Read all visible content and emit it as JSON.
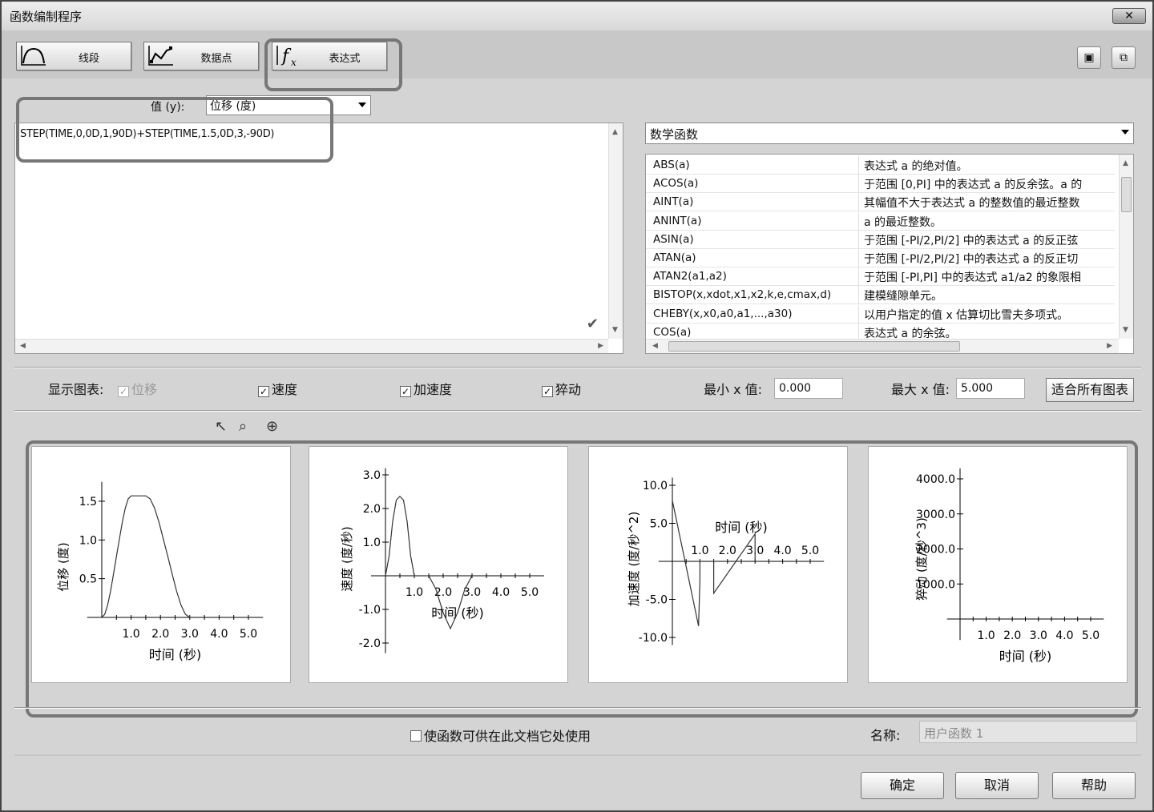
{
  "window": {
    "title": "函数编制程序",
    "close_label": "✕"
  },
  "toolbar": {
    "buttons": [
      {
        "label": "线段",
        "icon": "segment-curve-icon"
      },
      {
        "label": "数据点",
        "icon": "data-points-icon"
      },
      {
        "label": "表达式",
        "icon": "fx-icon"
      }
    ],
    "save_icon": "save-icon",
    "open_icon": "open-icon"
  },
  "value": {
    "label": "值 (y):",
    "selected": "位移 (度)"
  },
  "editor": {
    "expression": "STEP(TIME,0,0D,1,90D)+STEP(TIME,1.5,0D,3,-90D)"
  },
  "functions": {
    "category": "数学函数",
    "rows": [
      {
        "name": "ABS(a)",
        "desc": "表达式 a 的绝对值。"
      },
      {
        "name": "ACOS(a)",
        "desc": "于范围 [0,PI] 中的表达式 a 的反余弦。a 的"
      },
      {
        "name": "AINT(a)",
        "desc": "其幅值不大于表达式 a 的整数值的最近整数"
      },
      {
        "name": "ANINT(a)",
        "desc": "a 的最近整数。"
      },
      {
        "name": "ASIN(a)",
        "desc": "于范围 [-PI/2,PI/2] 中的表达式 a 的反正弦"
      },
      {
        "name": "ATAN(a)",
        "desc": "于范围 [-PI/2,PI/2] 中的表达式 a 的反正切"
      },
      {
        "name": "ATAN2(a1,a2)",
        "desc": "于范围 [-PI,PI] 中的表达式 a1/a2 的象限相"
      },
      {
        "name": "BISTOP(x,xdot,x1,x2,k,e,cmax,d)",
        "desc": "建模缝隙单元。"
      },
      {
        "name": "CHEBY(x,x0,a0,a1,...,a30)",
        "desc": "以用户指定的值 x 估算切比雪夫多项式。"
      },
      {
        "name": "COS(a)",
        "desc": "表达式 a 的余弦。"
      }
    ]
  },
  "display": {
    "label": "显示图表:",
    "displacement": "位移",
    "velocity": "速度",
    "acceleration": "加速度",
    "jerk": "猝动",
    "min_x_label": "最小 x 值:",
    "min_x": "0.000",
    "max_x_label": "最大 x 值:",
    "max_x": "5.000",
    "fit_label": "适合所有图表",
    "checked": {
      "displacement": true,
      "velocity": true,
      "acceleration": true,
      "jerk": true
    }
  },
  "footer": {
    "share_label": "使函数可供在此文档它处使用",
    "share_checked": false,
    "name_label": "名称:",
    "name_value": "用户函数 1",
    "ok": "确定",
    "cancel": "取消",
    "help": "帮助"
  },
  "chart_data": [
    {
      "type": "line",
      "xlabel": "时间 (秒)",
      "ylabel": "位移 (度)",
      "xticks": [
        "1.0",
        "2.0",
        "3.0",
        "4.0",
        "5.0"
      ],
      "yticks": [
        "0.5",
        "1.0",
        "1.5"
      ],
      "yvals": [
        0.5,
        1.0,
        1.5
      ],
      "xlim": [
        0,
        5.5
      ],
      "ylim": [
        0,
        1.75
      ],
      "x": [
        0,
        0.1,
        0.2,
        0.3,
        0.4,
        0.5,
        0.6,
        0.7,
        0.8,
        0.9,
        1,
        1.5,
        1.65,
        1.8,
        1.95,
        2.1,
        2.25,
        2.4,
        2.55,
        2.7,
        2.85,
        3
      ],
      "y": [
        0,
        0.04,
        0.16,
        0.34,
        0.56,
        0.79,
        1.01,
        1.23,
        1.41,
        1.53,
        1.57,
        1.57,
        1.53,
        1.41,
        1.23,
        1.01,
        0.79,
        0.56,
        0.34,
        0.16,
        0.04,
        0
      ]
    },
    {
      "type": "line",
      "xlabel": "时间 (秒)",
      "ylabel": "速度 (度/秒)",
      "xticks": [
        "1.0",
        "2.0",
        "3.0",
        "4.0",
        "5.0"
      ],
      "yticks": [
        "3.0",
        "2.0",
        "1.0",
        "-1.0",
        "-2.0"
      ],
      "yvals": [
        3,
        2,
        1,
        -1,
        -2
      ],
      "xlim": [
        0,
        5.5
      ],
      "ylim": [
        -2.3,
        3.2
      ],
      "x": [
        0,
        0.125,
        0.25,
        0.375,
        0.5,
        0.625,
        0.75,
        0.875,
        1,
        1.5,
        1.75,
        2,
        2.25,
        2.5,
        2.75,
        3
      ],
      "y": [
        0,
        0.58,
        1.62,
        2.25,
        2.36,
        2.25,
        1.62,
        0.58,
        0,
        0,
        0.4,
        1.1,
        1.57,
        1.1,
        0.4,
        0
      ],
      "y_note": "second hump is negative",
      "neg": [
        false,
        false,
        false,
        false,
        false,
        false,
        false,
        false,
        false,
        false,
        true,
        true,
        true,
        true,
        true,
        false
      ]
    },
    {
      "type": "line",
      "xlabel": "时间 (秒)",
      "ylabel": "加速度 (度/秒^2)",
      "xticks": [
        "1.0",
        "2.0",
        "3.0",
        "4.0",
        "5.0"
      ],
      "yticks": [
        "10.0",
        "5.0",
        "-5.0",
        "-10.0"
      ],
      "yvals": [
        10,
        5,
        -5,
        -10
      ],
      "xlim": [
        0,
        5.5
      ],
      "ylim": [
        -11,
        11
      ],
      "x": [
        0,
        0.95,
        0.95,
        1,
        1,
        1.5,
        1.5,
        1.5,
        3,
        3
      ],
      "y": [
        8,
        -8.5,
        -8.5,
        -2.5,
        0,
        0,
        0,
        -4.2,
        3.6,
        0
      ]
    },
    {
      "type": "line",
      "xlabel": "时间 (秒)",
      "ylabel": "猝动 (度/秒^3)",
      "xticks": [
        "1.0",
        "2.0",
        "3.0",
        "4.0",
        "5.0"
      ],
      "yticks": [
        "4000.0",
        "3000.0",
        "2000.0",
        "1000.0"
      ],
      "yvals": [
        4000,
        3000,
        2000,
        1000
      ],
      "xlim": [
        0,
        5.5
      ],
      "ylim": [
        -600,
        4300
      ],
      "x": [],
      "y": []
    }
  ]
}
